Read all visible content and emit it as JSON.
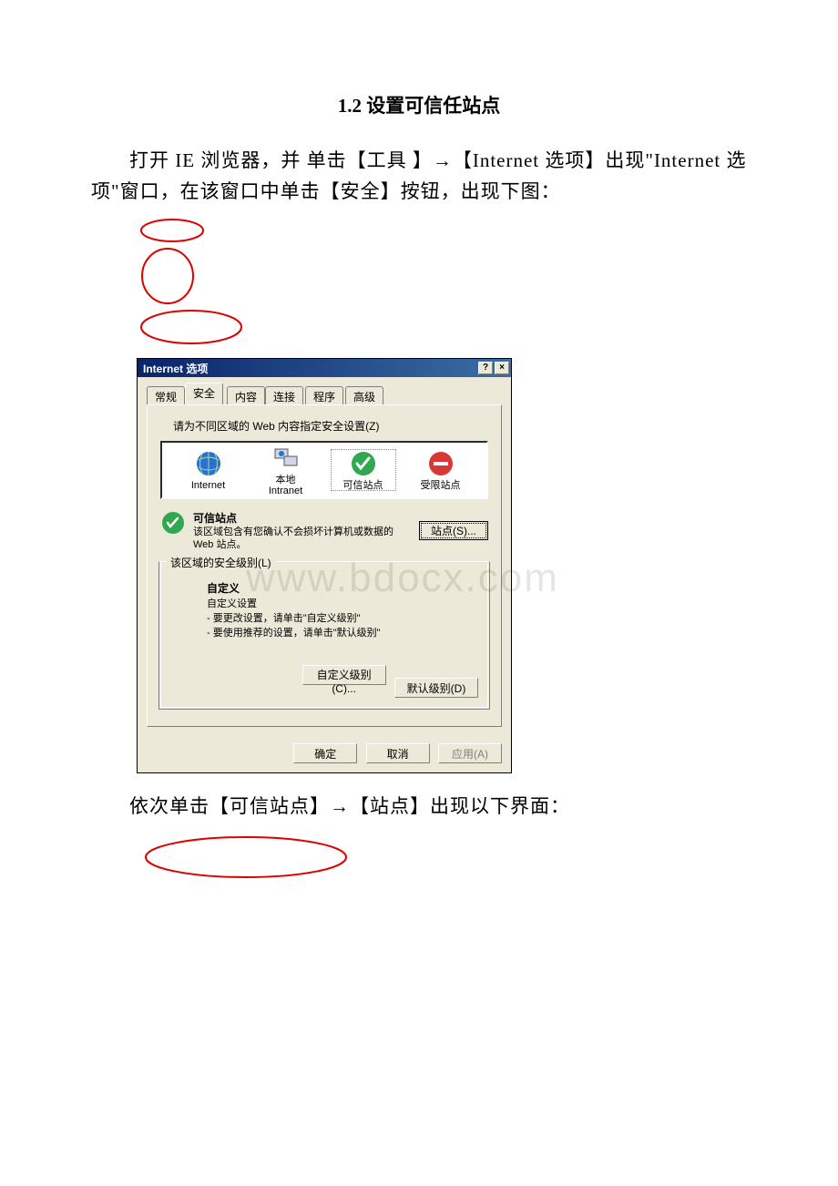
{
  "section_title": "1.2 设置可信任站点",
  "intro_text": "打开 IE 浏览器，并 单击【工具 】→【Internet 选项】出现\"Internet 选项\"窗口，在该窗口中单击【安全】按钮，出现下图：",
  "watermark": "www.bdocx.com",
  "dialog": {
    "title": "Internet 选项",
    "help_btn": "?",
    "close_btn": "×",
    "tabs": {
      "general": "常规",
      "security": "安全",
      "content": "内容",
      "connections": "连接",
      "programs": "程序",
      "advanced": "高级"
    },
    "zone_instruction": "请为不同区域的 Web 内容指定安全设置(Z)",
    "zones": {
      "internet": "Internet",
      "local": "本地\nIntranet",
      "trusted": "可信站点",
      "restricted": "受限站点"
    },
    "info": {
      "title": "可信站点",
      "desc": "该区域包含有您确认不会损坏计算机或数据的 Web 站点。"
    },
    "sites_button": "站点(S)...",
    "group_legend": "该区域的安全级别(L)",
    "custom": {
      "title": "自定义",
      "line1": "自定义设置",
      "line2": "- 要更改设置，请单击\"自定义级别\"",
      "line3": "- 要使用推荐的设置，请单击\"默认级别\""
    },
    "custom_level_btn": "自定义级别(C)...",
    "default_level_btn": "默认级别(D)",
    "ok_btn": "确定",
    "cancel_btn": "取消",
    "apply_btn": "应用(A)"
  },
  "outro_text": "依次单击【可信站点】→【站点】出现以下界面："
}
